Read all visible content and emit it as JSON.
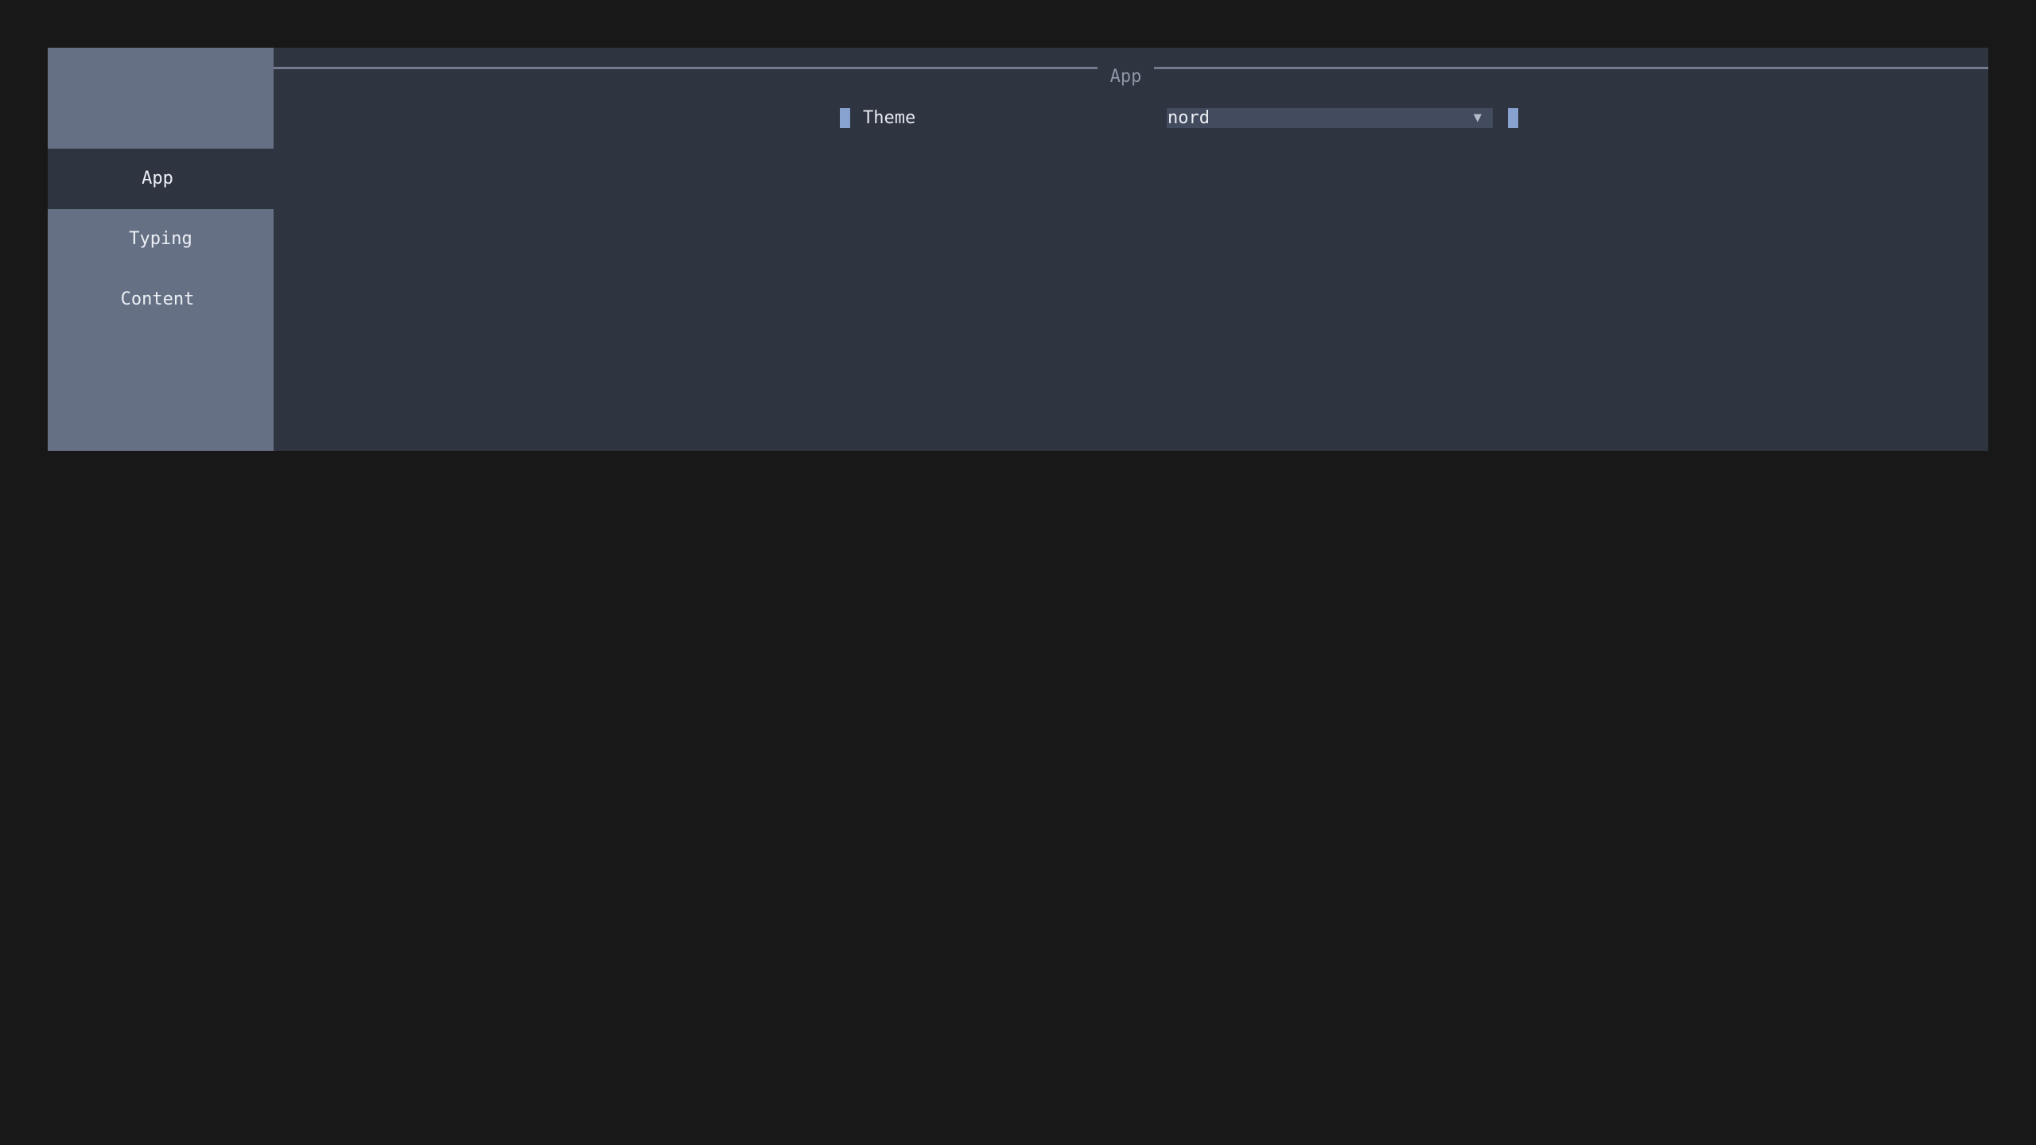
{
  "sidebar": {
    "items": [
      {
        "label": "App",
        "active": true
      },
      {
        "label": "Typing",
        "active": false
      },
      {
        "label": "Content",
        "active": false
      }
    ]
  },
  "main": {
    "section_title": "App",
    "settings": [
      {
        "label": "Theme",
        "value": "nord",
        "control": "dropdown",
        "icon": "chevron-down-icon"
      }
    ]
  },
  "colors": {
    "background": "#181818",
    "panel": "#2e3440",
    "sidebar": "#667085",
    "select": "#434c5e",
    "accent": "#88a2d0",
    "text": "#eceff4"
  }
}
